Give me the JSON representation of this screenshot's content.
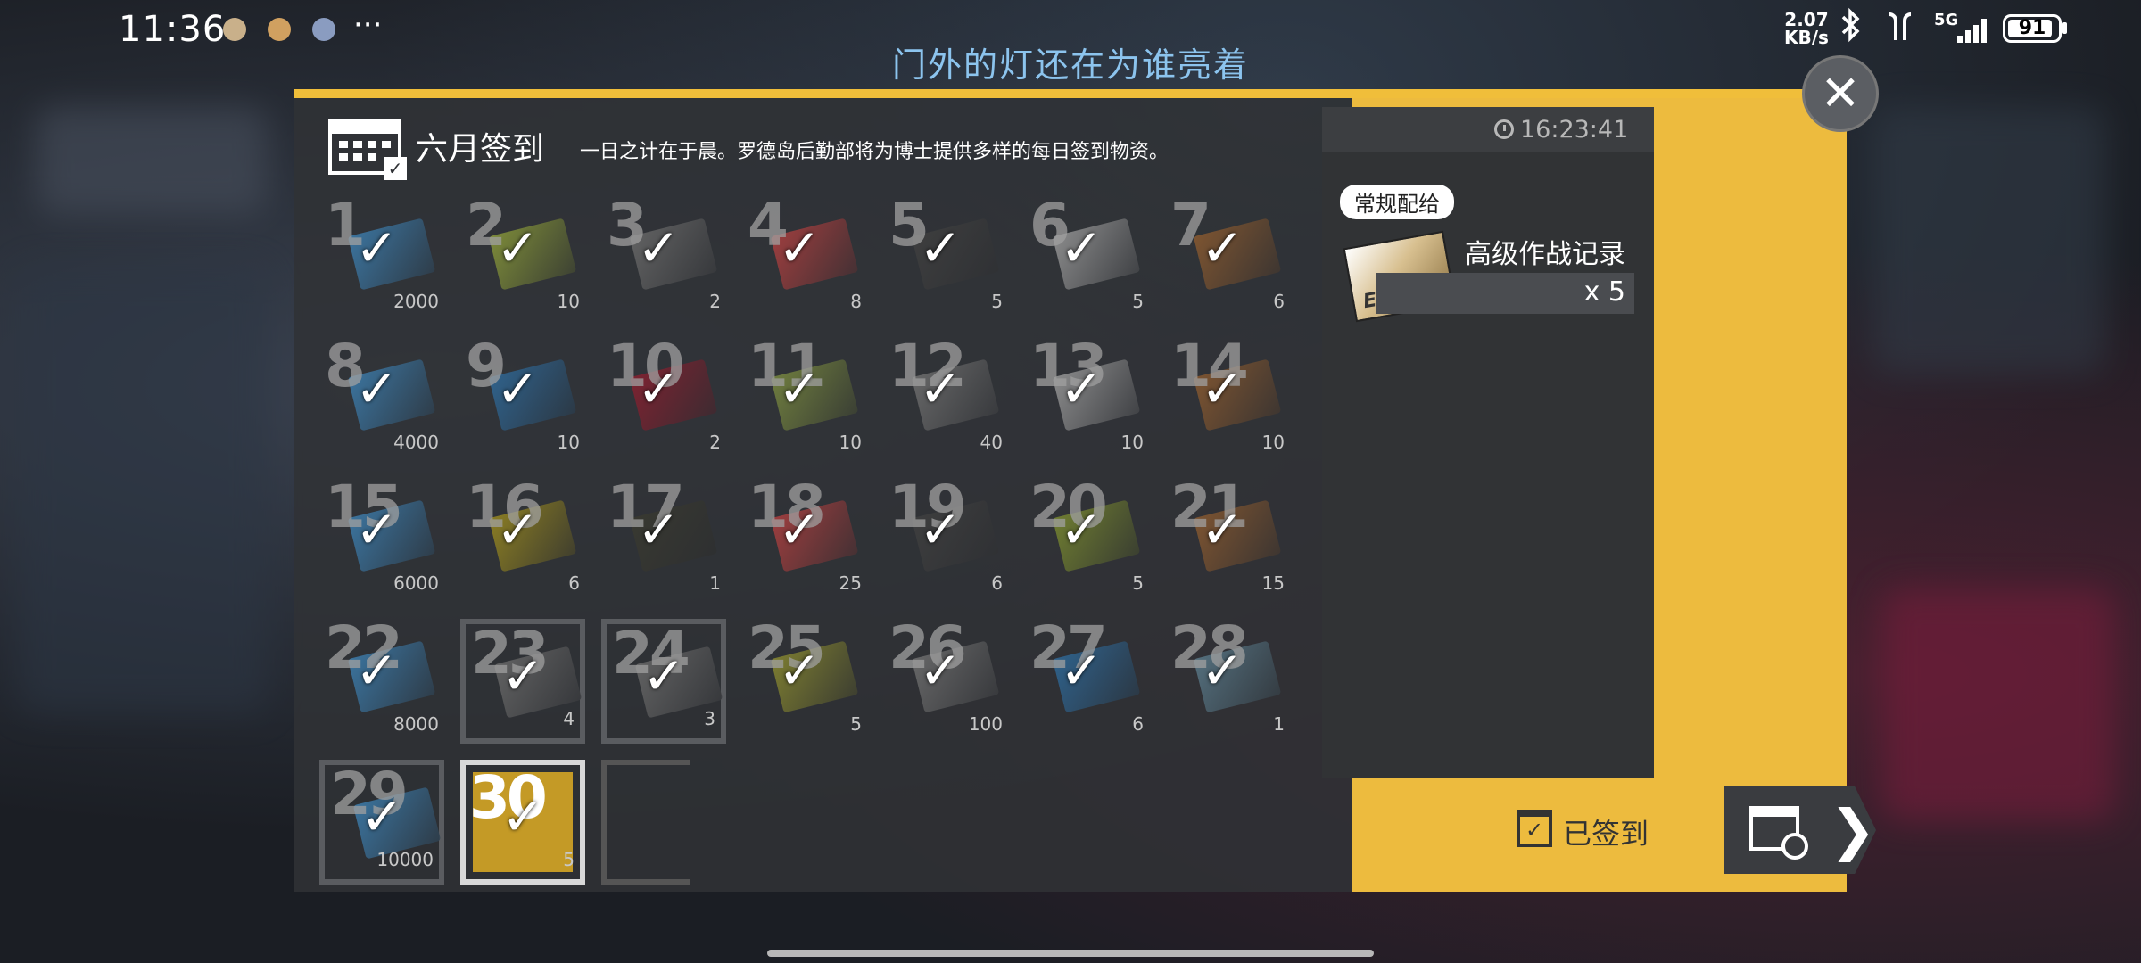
{
  "status_bar": {
    "time": "11:36",
    "more": "···",
    "net_speed_value": "2.07",
    "net_speed_unit": "KB/s",
    "network": "5G",
    "battery": "91",
    "battery_level": 0.91
  },
  "banner": {
    "title": "门外的灯还在为谁亮着"
  },
  "panel": {
    "title": "六月签到",
    "description": "一日之计在于晨。罗德岛后勤部将为博士提供多样的每日签到物资。"
  },
  "days": [
    {
      "day": "1",
      "qty": "2000",
      "color": "#3d7fb0"
    },
    {
      "day": "2",
      "qty": "10",
      "color": "#8a9a3a"
    },
    {
      "day": "3",
      "qty": "2",
      "color": "#6a6a6a"
    },
    {
      "day": "4",
      "qty": "8",
      "color": "#b04040"
    },
    {
      "day": "5",
      "qty": "5",
      "color": "#404040"
    },
    {
      "day": "6",
      "qty": "5",
      "color": "#9a9a9a"
    },
    {
      "day": "7",
      "qty": "6",
      "color": "#8a5a30"
    },
    {
      "day": "8",
      "qty": "4000",
      "color": "#3d7fb0"
    },
    {
      "day": "9",
      "qty": "10",
      "color": "#2f6a9a"
    },
    {
      "day": "10",
      "qty": "2",
      "color": "#8a2030"
    },
    {
      "day": "11",
      "qty": "10",
      "color": "#7a8a40"
    },
    {
      "day": "12",
      "qty": "40",
      "color": "#707070"
    },
    {
      "day": "13",
      "qty": "10",
      "color": "#9a9a9a"
    },
    {
      "day": "14",
      "qty": "10",
      "color": "#8a5a30"
    },
    {
      "day": "15",
      "qty": "6000",
      "color": "#3d7fb0"
    },
    {
      "day": "16",
      "qty": "6",
      "color": "#9a8a20"
    },
    {
      "day": "17",
      "qty": "1",
      "color": "#3a3a30"
    },
    {
      "day": "18",
      "qty": "25",
      "color": "#b04040"
    },
    {
      "day": "19",
      "qty": "6",
      "color": "#404040"
    },
    {
      "day": "20",
      "qty": "5",
      "color": "#7a8a30"
    },
    {
      "day": "21",
      "qty": "15",
      "color": "#8a5a30"
    },
    {
      "day": "22",
      "qty": "8000",
      "color": "#3d7fb0"
    },
    {
      "day": "23",
      "qty": "4",
      "color": "#6a6a6a"
    },
    {
      "day": "24",
      "qty": "3",
      "color": "#6a6a6a"
    },
    {
      "day": "25",
      "qty": "5",
      "color": "#8a8a30"
    },
    {
      "day": "26",
      "qty": "100",
      "color": "#707070"
    },
    {
      "day": "27",
      "qty": "6",
      "color": "#2f6a9a"
    },
    {
      "day": "28",
      "qty": "1",
      "color": "#5a7a8a"
    },
    {
      "day": "29",
      "qty": "10000",
      "color": "#3d7fb0"
    },
    {
      "day": "30",
      "qty": "5",
      "color": "#c49a26"
    }
  ],
  "checkmark": "✓",
  "info": {
    "time": "16:23:41",
    "supply_tag": "常规配给",
    "reward_name": "高级作战记录",
    "reward_qty": "x 5",
    "reward_thumb_label": "EXP"
  },
  "signed": {
    "icon": "✓",
    "label": "已签到"
  },
  "calendar_button": {
    "arrow": "❯"
  },
  "close_button": {
    "icon": "✕"
  }
}
